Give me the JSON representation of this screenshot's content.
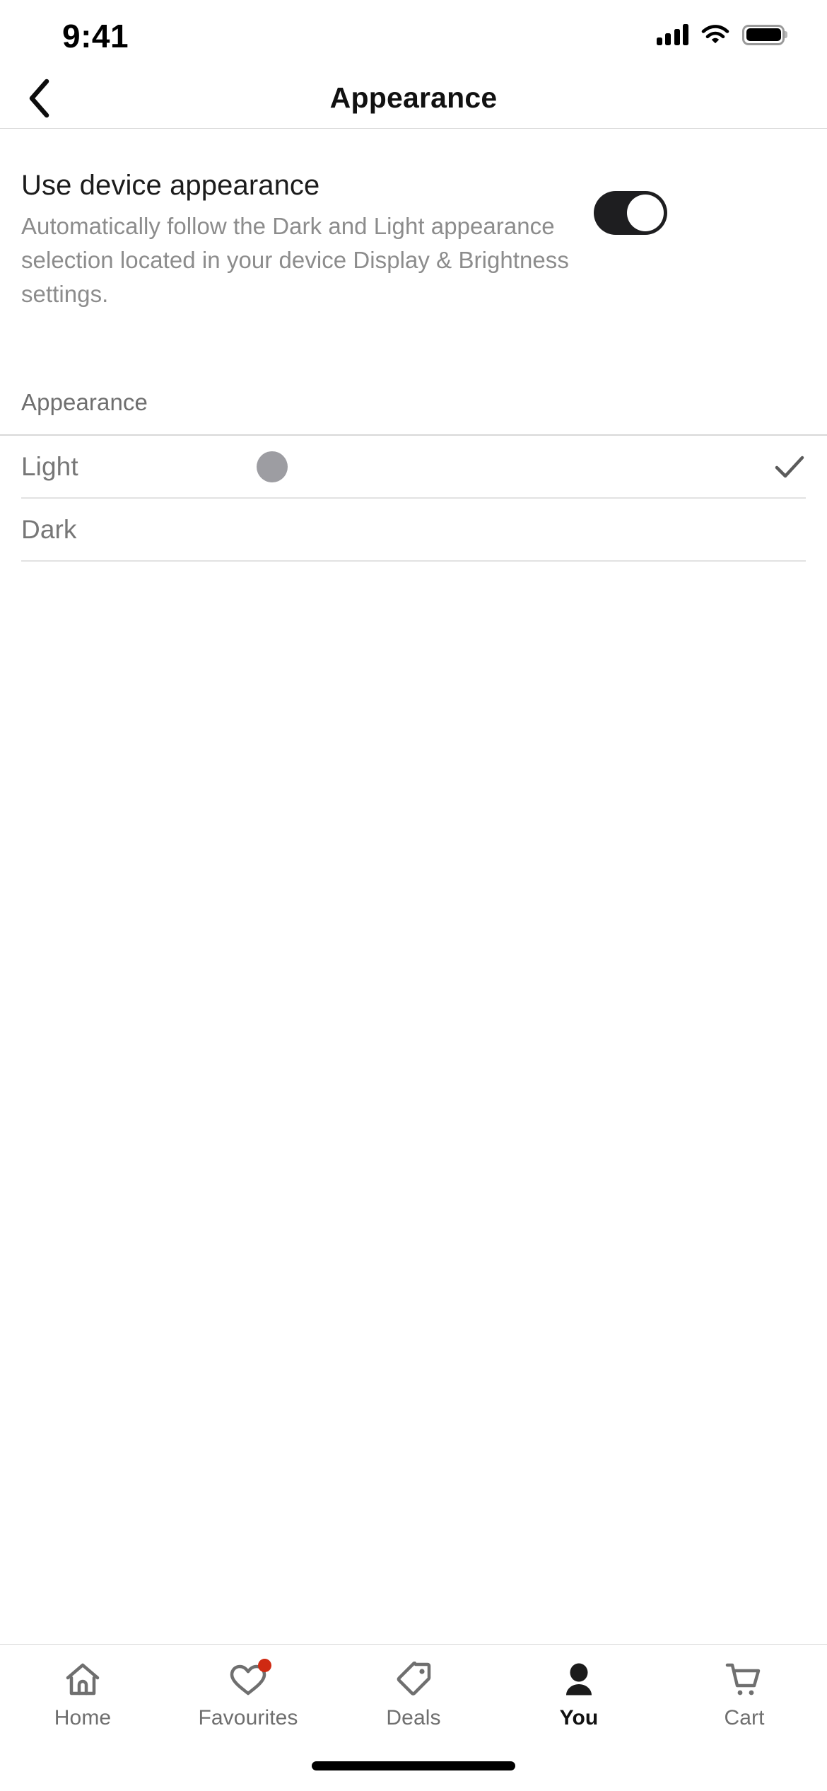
{
  "status_bar": {
    "time": "9:41",
    "signal_icon": "cellular-signal-icon",
    "wifi_icon": "wifi-icon",
    "battery_icon": "battery-icon"
  },
  "nav_bar": {
    "back_icon": "chevron-left-icon",
    "title": "Appearance"
  },
  "device_appearance": {
    "title": "Use device appearance",
    "description": "Automatically follow the Dark and Light appearance selection located in your device Display & Brightness settings.",
    "toggle_state": "on",
    "toggle_color": "#1e1e20"
  },
  "appearance_section": {
    "label": "Appearance",
    "options": [
      {
        "label": "Light",
        "selected": true,
        "swatch": true,
        "swatch_color": "#9d9da2",
        "check_icon": "checkmark-icon"
      },
      {
        "label": "Dark",
        "selected": false,
        "swatch": false,
        "swatch_color": "",
        "check_icon": ""
      }
    ]
  },
  "tab_bar": {
    "items": [
      {
        "label": "Home",
        "icon": "home-icon",
        "active": false,
        "badge": false
      },
      {
        "label": "Favourites",
        "icon": "heart-icon",
        "active": false,
        "badge": true,
        "badge_color": "#cf2a12"
      },
      {
        "label": "Deals",
        "icon": "tag-icon",
        "active": false,
        "badge": false
      },
      {
        "label": "You",
        "icon": "person-icon",
        "active": true,
        "badge": false
      },
      {
        "label": "Cart",
        "icon": "shopping-cart-icon",
        "active": false,
        "badge": false
      }
    ]
  },
  "home_indicator": {
    "present": true
  }
}
